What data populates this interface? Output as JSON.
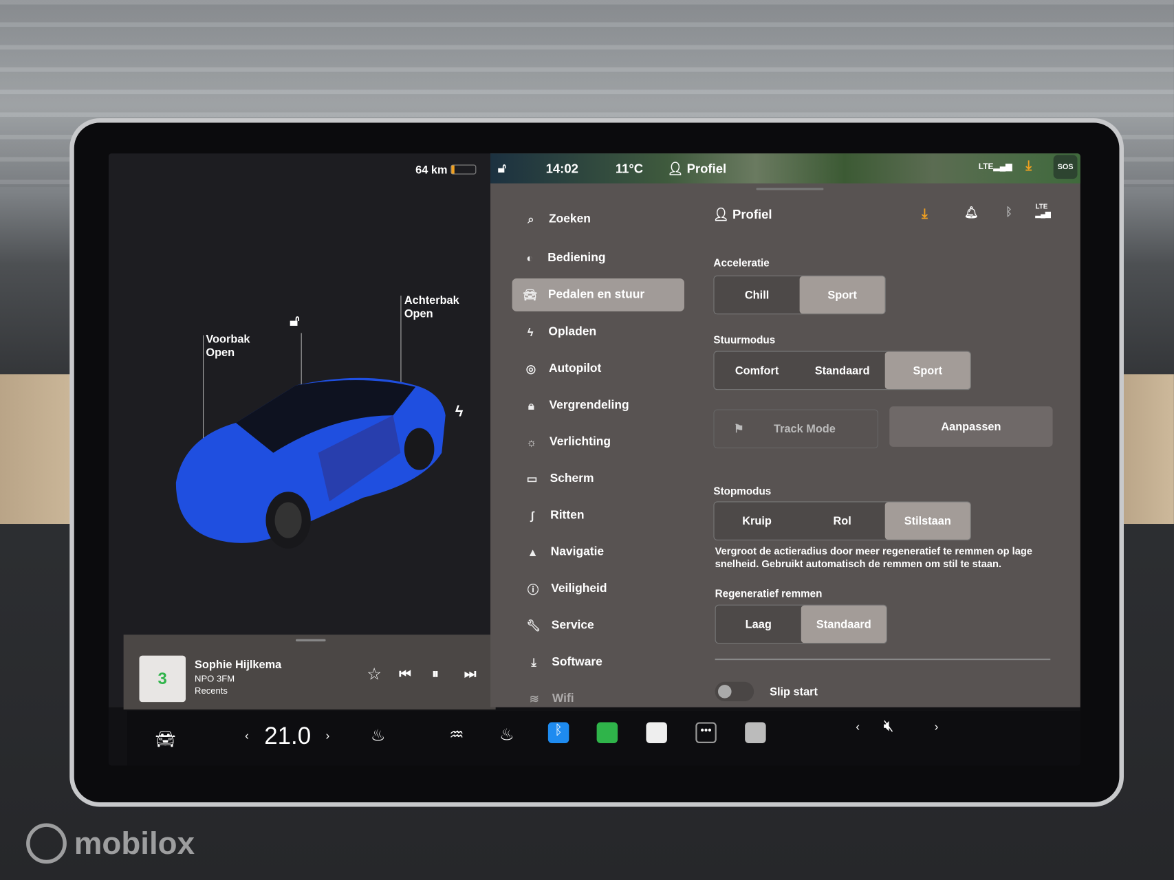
{
  "top_left": {
    "range": "64 km"
  },
  "status_bar": {
    "time": "14:02",
    "temperature": "11°C",
    "profile": "Profiel",
    "network": "LTE",
    "sos": "SOS"
  },
  "car": {
    "frunk_label": "Voorbak",
    "frunk_state": "Open",
    "trunk_label": "Achterbak",
    "trunk_state": "Open",
    "color": "#1f4fe0"
  },
  "media": {
    "title": "Sophie Hijlkema",
    "station": "NPO 3FM",
    "source": "Recents",
    "logo_text": "npo 3fm"
  },
  "menu": {
    "items": [
      {
        "label": "Zoeken",
        "icon": "search-icon"
      },
      {
        "label": "Bediening",
        "icon": "toggle-icon"
      },
      {
        "label": "Pedalen en stuur",
        "icon": "car-icon",
        "selected": true
      },
      {
        "label": "Opladen",
        "icon": "bolt-icon"
      },
      {
        "label": "Autopilot",
        "icon": "steering-wheel-icon"
      },
      {
        "label": "Vergrendeling",
        "icon": "lock-icon"
      },
      {
        "label": "Verlichting",
        "icon": "sun-icon"
      },
      {
        "label": "Scherm",
        "icon": "display-icon"
      },
      {
        "label": "Ritten",
        "icon": "trips-icon"
      },
      {
        "label": "Navigatie",
        "icon": "navigation-icon"
      },
      {
        "label": "Veiligheid",
        "icon": "info-icon"
      },
      {
        "label": "Service",
        "icon": "wrench-icon"
      },
      {
        "label": "Software",
        "icon": "download-icon"
      },
      {
        "label": "Wifi",
        "icon": "wifi-icon"
      }
    ]
  },
  "content": {
    "header": {
      "profile": "Profiel",
      "network": "LTE"
    },
    "acceleratie": {
      "title": "Acceleratie",
      "options": [
        "Chill",
        "Sport"
      ],
      "selected": "Sport"
    },
    "stuurmodus": {
      "title": "Stuurmodus",
      "options": [
        "Comfort",
        "Standaard",
        "Sport"
      ],
      "selected": "Sport"
    },
    "track_mode": {
      "label": "Track Mode",
      "button": "Aanpassen"
    },
    "stopmodus": {
      "title": "Stopmodus",
      "options": [
        "Kruip",
        "Rol",
        "Stilstaan"
      ],
      "selected": "Stilstaan",
      "description": "Vergroot de actieradius door meer regeneratief te remmen op lage snelheid. Gebruikt automatisch de remmen om stil te staan."
    },
    "regen": {
      "title": "Regeneratief remmen",
      "options": [
        "Laag",
        "Standaard"
      ],
      "selected": "Standaard"
    },
    "slip_start": {
      "label": "Slip start",
      "enabled": false
    }
  },
  "bottom_bar": {
    "temperature": "21.0",
    "volume": "muted"
  },
  "colors": {
    "accent_orange": "#f0a020",
    "bluetooth": "#1e8bf0",
    "green_app": "#2fb44a"
  },
  "watermark": "mobilox"
}
